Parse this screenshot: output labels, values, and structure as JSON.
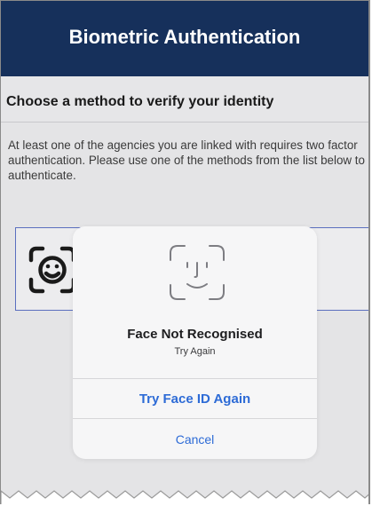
{
  "header": {
    "title": "Biometric Authentication"
  },
  "subheader": {
    "title": "Choose a method to verify your identity"
  },
  "info": {
    "text": "At least one of the agencies you are linked with requires two factor authentication. Please use one of the methods from the list below to authenticate."
  },
  "method_list": {
    "items": [
      {
        "icon": "face-id-icon"
      }
    ]
  },
  "dialog": {
    "icon": "face-id-icon",
    "title": "Face Not Recognised",
    "subtitle": "Try Again",
    "retry_label": "Try Face ID Again",
    "cancel_label": "Cancel"
  },
  "colors": {
    "header_bg": "#16305b",
    "accent": "#2d6bd6",
    "method_border": "#5b6fbf"
  }
}
